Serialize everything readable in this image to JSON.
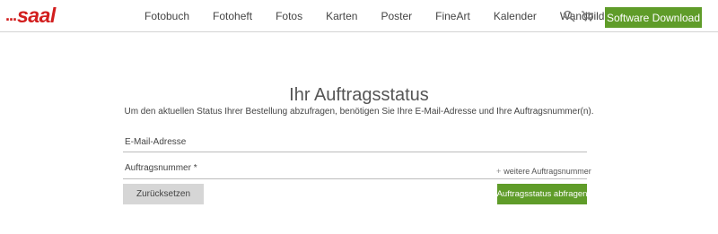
{
  "header": {
    "logo_dots": "...",
    "logo_text": "saal",
    "nav": [
      "Fotobuch",
      "Fotoheft",
      "Fotos",
      "Karten",
      "Poster",
      "FineArt",
      "Kalender",
      "Wandbilder"
    ],
    "download_label": "Software Download"
  },
  "form": {
    "title": "Ihr Auftragsstatus",
    "subtitle": "Um den aktuellen Status Ihrer Bestellung abzufragen, benötigen Sie Ihre E-Mail-Adresse und Ihre Auftragsnummer(n).",
    "email_label": "E-Mail-Adresse",
    "email_value": "",
    "order_label": "Auftragsnummer *",
    "order_value": "",
    "more_link": "weitere Auftragsnummer",
    "more_link_icon": "+",
    "reset_label": "Zurücksetzen",
    "submit_label": "Auftragsstatus abfragen"
  },
  "colors": {
    "brand_red": "#d21e1e",
    "accent_green": "#5f9c29",
    "reset_gray": "#d6d6d6"
  },
  "icons": [
    "search-icon",
    "cart-icon"
  ]
}
